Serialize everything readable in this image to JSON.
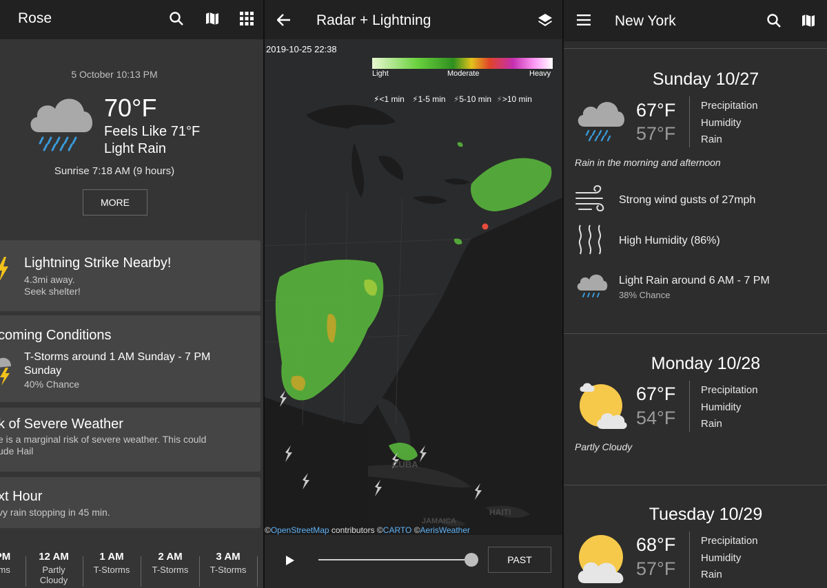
{
  "left": {
    "title": "Rose",
    "date": "5 October 10:13 PM",
    "temp": "70°F",
    "feels": "Feels Like 71°F",
    "condition": "Light Rain",
    "sunrise": "Sunrise 7:18 AM (9 hours)",
    "more": "MORE",
    "alert": {
      "title": "Lightning Strike Nearby!",
      "line1": "4.3mi away.",
      "line2": "Seek shelter!"
    },
    "upcoming": {
      "title": "coming Conditions",
      "line1": "T-Storms around 1 AM Sunday - 7 PM",
      "line2": "Sunday",
      "line3": "40% Chance"
    },
    "severe": {
      "title": "k of Severe Weather",
      "line1": "e is a marginal risk of severe weather. This could",
      "line2": "ude Hail"
    },
    "next": {
      "title": "xt Hour",
      "line1": "vy rain stopping in 45 min."
    },
    "hourly": [
      {
        "h": "PM",
        "c": "rms",
        "c2": ""
      },
      {
        "h": "12 AM",
        "c": "Partly",
        "c2": "Cloudy"
      },
      {
        "h": "1 AM",
        "c": "T-Storms",
        "c2": ""
      },
      {
        "h": "2 AM",
        "c": "T-Storms",
        "c2": ""
      },
      {
        "h": "3 AM",
        "c": "T-Storms",
        "c2": ""
      }
    ]
  },
  "middle": {
    "title": "Radar + Lightning",
    "timestamp": "2019-10-25 22:38",
    "legend": {
      "light": "Light",
      "moderate": "Moderate",
      "heavy": "Heavy"
    },
    "lightning": [
      "<1 min",
      "1-5 min",
      "5-10 min",
      ">10 min"
    ],
    "places": {
      "cuba": "CUBA",
      "haiti": "HAITI",
      "jamaica": "JAMAICA"
    },
    "attribution": {
      "prefix": "©",
      "osm": "OpenStreetMap",
      "mid": " contributors ©",
      "carto": "CARTO",
      "mid2": " ©",
      "aeris": "AerisWeather"
    },
    "slider_value": 1.0,
    "past": "PAST"
  },
  "right": {
    "title": "New York",
    "days": [
      {
        "title": "Sunday 10/27",
        "hi": "67°F",
        "lo": "57°F",
        "summary": "Rain in the morning and afternoon"
      },
      {
        "title": "Monday 10/28",
        "hi": "67°F",
        "lo": "54°F",
        "summary": "Partly Cloudy"
      },
      {
        "title": "Tuesday 10/29",
        "hi": "68°F",
        "lo": "57°F",
        "summary": ""
      }
    ],
    "labels": {
      "precip": "Precipitation",
      "humidity": "Humidity",
      "rain": "Rain"
    },
    "details": {
      "wind": "Strong wind gusts of 27mph",
      "humidity": "High Humidity (86%)",
      "rain": "Light Rain around 6 AM - 7 PM",
      "rain_chance": "38% Chance"
    }
  },
  "colors": {
    "accent_lightning": "#f2c21b",
    "rain_blue": "#3a9ad9",
    "sun": "#f6c94a",
    "radar_green": "#58b53c"
  }
}
